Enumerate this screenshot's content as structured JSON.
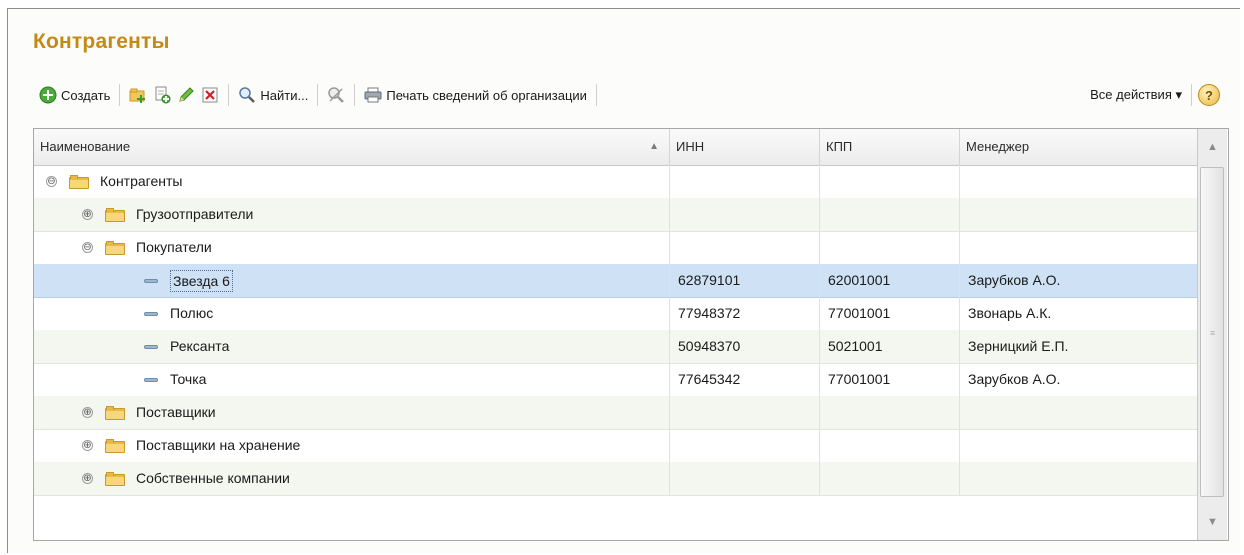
{
  "title": "Контрагенты",
  "toolbar": {
    "create_label": "Создать",
    "find_label": "Найти...",
    "print_label": "Печать сведений об организации",
    "all_actions_label": "Все действия ▾",
    "help_label": "?"
  },
  "table": {
    "headers": {
      "name": "Наименование",
      "inn": "ИНН",
      "kpp": "КПП",
      "manager": "Менеджер"
    },
    "rows": [
      {
        "name": "Контрагенты",
        "inn": "",
        "kpp": "",
        "manager": "",
        "type": "group",
        "toggle": "⊖",
        "level": 0
      },
      {
        "name": "Грузоотправители",
        "inn": "",
        "kpp": "",
        "manager": "",
        "type": "group",
        "toggle": "⊕",
        "level": 1
      },
      {
        "name": "Покупатели",
        "inn": "",
        "kpp": "",
        "manager": "",
        "type": "group",
        "toggle": "⊖",
        "level": 1
      },
      {
        "name": "Звезда 6",
        "inn": "62879101",
        "kpp": "62001001",
        "manager": "Зарубков А.О.",
        "type": "item",
        "level": 2,
        "selected": true
      },
      {
        "name": "Полюс",
        "inn": "77948372",
        "kpp": "77001001",
        "manager": "Звонарь А.К.",
        "type": "item",
        "level": 2
      },
      {
        "name": "Рексанта",
        "inn": "50948370",
        "kpp": "5021001",
        "manager": "Зерницкий Е.П.",
        "type": "item",
        "level": 2
      },
      {
        "name": "Точка",
        "inn": "77645342",
        "kpp": "77001001",
        "manager": "Зарубков А.О.",
        "type": "item",
        "level": 2
      },
      {
        "name": "Поставщики",
        "inn": "",
        "kpp": "",
        "manager": "",
        "type": "group",
        "toggle": "⊕",
        "level": 1
      },
      {
        "name": "Поставщики на хранение",
        "inn": "",
        "kpp": "",
        "manager": "",
        "type": "group",
        "toggle": "⊕",
        "level": 1
      },
      {
        "name": "Собственные компании",
        "inn": "",
        "kpp": "",
        "manager": "",
        "type": "group",
        "toggle": "⊕",
        "level": 1
      }
    ]
  },
  "colors": {
    "title": "#c58a16",
    "selected_row": "#cfe1f5",
    "alt_row": "#f3f7ef"
  }
}
